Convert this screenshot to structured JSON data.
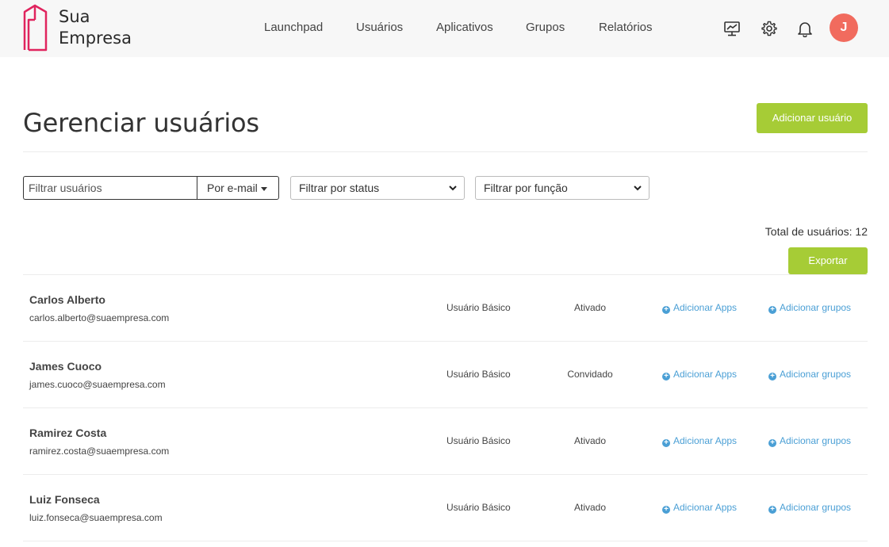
{
  "header": {
    "logo_line1": "Sua",
    "logo_line2": "Empresa",
    "nav": [
      "Launchpad",
      "Usuários",
      "Aplicativos",
      "Grupos",
      "Relatórios"
    ],
    "icons": [
      "monitor-chart-icon",
      "gear-icon",
      "bell-icon"
    ],
    "avatar_initial": "J"
  },
  "page": {
    "title": "Gerenciar usuários",
    "add_user_label": "Adicionar usuário"
  },
  "filters": {
    "search_placeholder": "Filtrar usuários",
    "search_by": "Por e-mail",
    "status_placeholder": "Filtrar por status",
    "role_placeholder": "Filtrar por função"
  },
  "summary": {
    "total_label": "Total de usuários: 12",
    "export_label": "Exportar"
  },
  "users": [
    {
      "name": "Carlos Alberto",
      "email": "carlos.alberto@suaempresa.com",
      "role": "Usuário Básico",
      "status": "Ativado",
      "add_apps": "Adicionar Apps",
      "add_groups": "Adicionar grupos"
    },
    {
      "name": "James Cuoco",
      "email": "james.cuoco@suaempresa.com",
      "role": "Usuário Básico",
      "status": "Convidado",
      "add_apps": "Adicionar Apps",
      "add_groups": "Adicionar grupos"
    },
    {
      "name": "Ramirez Costa",
      "email": "ramirez.costa@suaempresa.com",
      "role": "Usuário Básico",
      "status": "Ativado",
      "add_apps": "Adicionar Apps",
      "add_groups": "Adicionar grupos"
    },
    {
      "name": "Luiz Fonseca",
      "email": "luiz.fonseca@suaempresa.com",
      "role": "Usuário Básico",
      "status": "Ativado",
      "add_apps": "Adicionar Apps",
      "add_groups": "Adicionar grupos"
    }
  ],
  "colors": {
    "accent_green": "#a6cc36",
    "link_blue": "#4a9fd5",
    "avatar_red": "#f16b5e",
    "logo_pink": "#e0245e"
  }
}
